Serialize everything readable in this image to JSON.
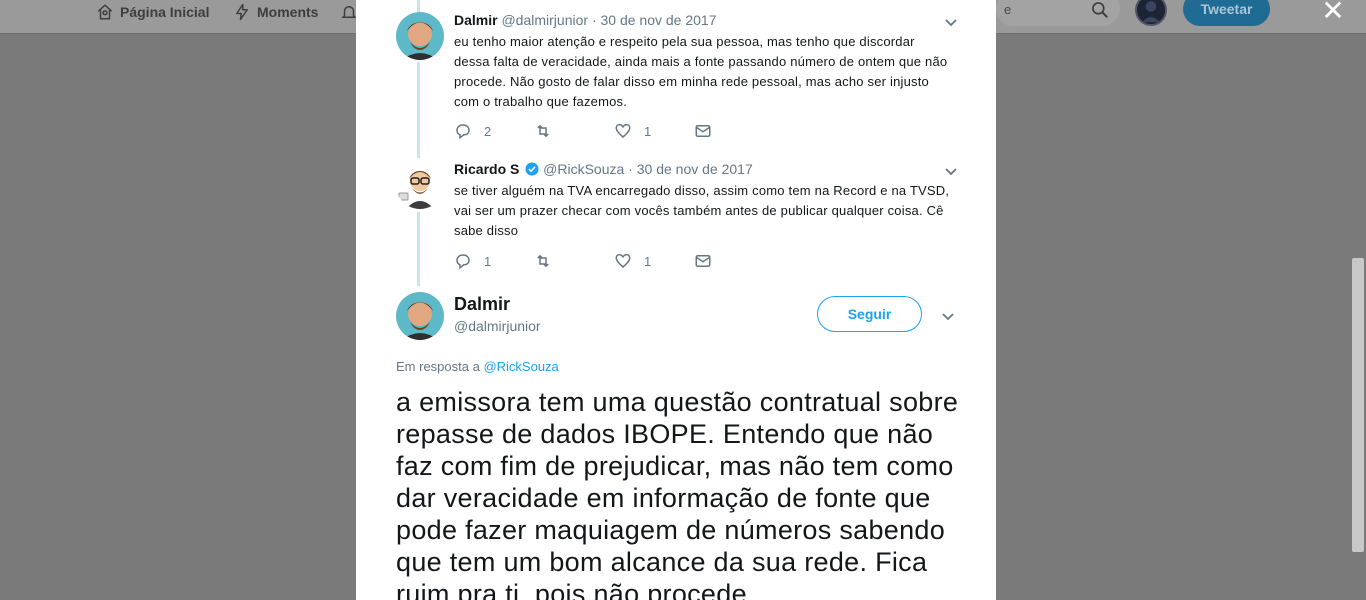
{
  "nav": {
    "home_label": "Página Inicial",
    "moments_label": "Moments",
    "search_placeholder": "e",
    "tweet_button": "Tweetar",
    "close": "✕"
  },
  "thread": [
    {
      "name": "Dalmir",
      "handle": "@dalmirjunior",
      "date": "30 de nov de 2017",
      "verified": false,
      "text": "eu tenho maior atenção e respeito pela sua pessoa, mas tenho que discordar dessa falta de veracidade, ainda mais a fonte passando número de ontem que não procede. Não gosto de falar disso em minha rede pessoal, mas acho ser injusto com o trabalho que fazemos.",
      "replies": "2",
      "retweets": "",
      "likes": "1"
    },
    {
      "name": "Ricardo S",
      "handle": "@RickSouza",
      "date": "30 de nov de 2017",
      "verified": true,
      "text": "se tiver alguém na TVA encarregado disso, assim como tem na Record e na TVSD, vai ser um prazer checar com vocês também antes de publicar qualquer coisa. Cê sabe disso",
      "replies": "1",
      "retweets": "",
      "likes": "1"
    }
  ],
  "main_tweet": {
    "name": "Dalmir",
    "handle": "@dalmirjunior",
    "follow_label": "Seguir",
    "reply_prefix": "Em resposta a",
    "reply_to": "@RickSouza",
    "text": "a emissora tem uma questão contratual sobre repasse de dados IBOPE. Entendo que não faz com fim de prejudicar, mas não tem como dar veracidade em informação de fonte que pode fazer maquiagem de números sabendo que tem um bom alcance da sua rede. Fica ruim pra ti, pois não procede."
  },
  "colors": {
    "accent": "#1da1f2",
    "text": "#14171a",
    "muted": "#657786",
    "thread_line": "#c4e3f5"
  }
}
